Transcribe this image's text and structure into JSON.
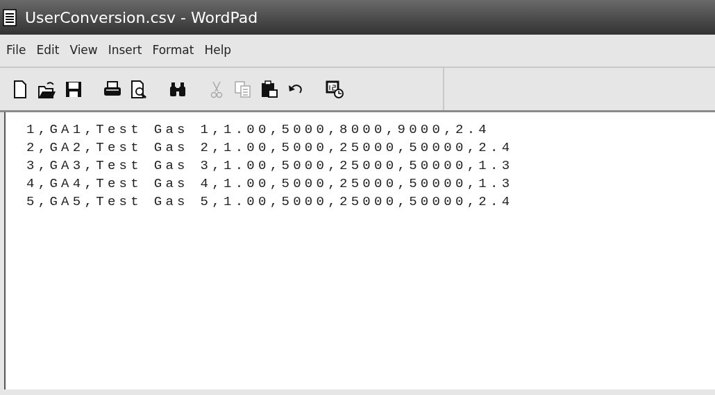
{
  "window": {
    "title": "UserConversion.csv - WordPad"
  },
  "menu": [
    "File",
    "Edit",
    "View",
    "Insert",
    "Format",
    "Help"
  ],
  "toolbar": [
    {
      "kind": "new",
      "disabled": false
    },
    {
      "kind": "open",
      "disabled": false
    },
    {
      "kind": "save",
      "disabled": false
    },
    {
      "kind": "sep"
    },
    {
      "kind": "print",
      "disabled": false
    },
    {
      "kind": "preview",
      "disabled": false
    },
    {
      "kind": "sep"
    },
    {
      "kind": "find",
      "disabled": false
    },
    {
      "kind": "sep"
    },
    {
      "kind": "cut",
      "disabled": true
    },
    {
      "kind": "copy",
      "disabled": true
    },
    {
      "kind": "paste",
      "disabled": false
    },
    {
      "kind": "undo",
      "disabled": false
    },
    {
      "kind": "sep"
    },
    {
      "kind": "datetime",
      "disabled": false
    }
  ],
  "document": {
    "lines": [
      "1,GA1,Test Gas 1,1.00,5000,8000,9000,2.4",
      "2,GA2,Test Gas 2,1.00,5000,25000,50000,2.4",
      "3,GA3,Test Gas 3,1.00,5000,25000,50000,1.3",
      "4,GA4,Test Gas 4,1.00,5000,25000,50000,1.3",
      "5,GA5,Test Gas 5,1.00,5000,25000,50000,2.4"
    ]
  }
}
